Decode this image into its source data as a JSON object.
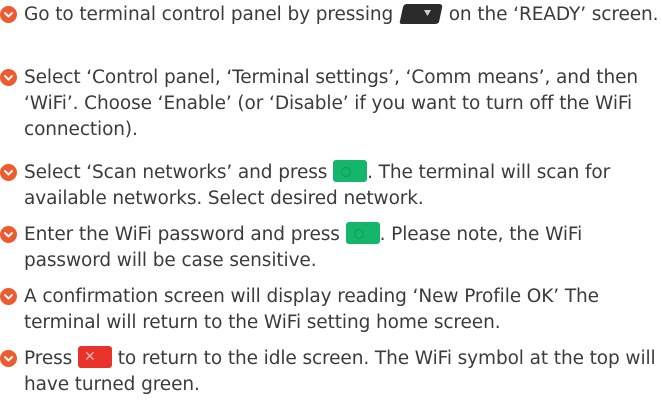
{
  "steps": [
    {
      "before": "Go to terminal control panel by pressing",
      "key_icon": "dark-nav-down-key-icon",
      "after": "on the ‘READY’ screen."
    },
    {
      "text": "Select ‘Control panel, ‘Terminal settings’, ‘Comm means’, and then ‘WiFi’. Choose ‘Enable’ (or ‘Disable’ if you want to turn off the WiFi connection)."
    },
    {
      "before": "Select ‘Scan networks’ and press",
      "key_icon": "green-enter-key-icon",
      "after": ". The terminal will scan for available networks. Select desired network."
    },
    {
      "before": "Enter the WiFi password and press",
      "key_icon": "green-enter-key-icon",
      "after": ". Please note, the WiFi password will be case sensitive."
    },
    {
      "text": "A confirmation screen will display reading ‘New Profile OK’ The terminal will return to the WiFi setting home screen."
    },
    {
      "before": "Press",
      "key_icon": "red-cancel-key-icon",
      "after": "to return to the idle screen. The WiFi symbol at the top will have turned green."
    }
  ],
  "colors": {
    "bullet": "#ef5a2f",
    "text": "#3b3b3b",
    "green_key": "#14b66b",
    "red_key": "#e8332c",
    "nav_key": "#2b2b2b"
  }
}
